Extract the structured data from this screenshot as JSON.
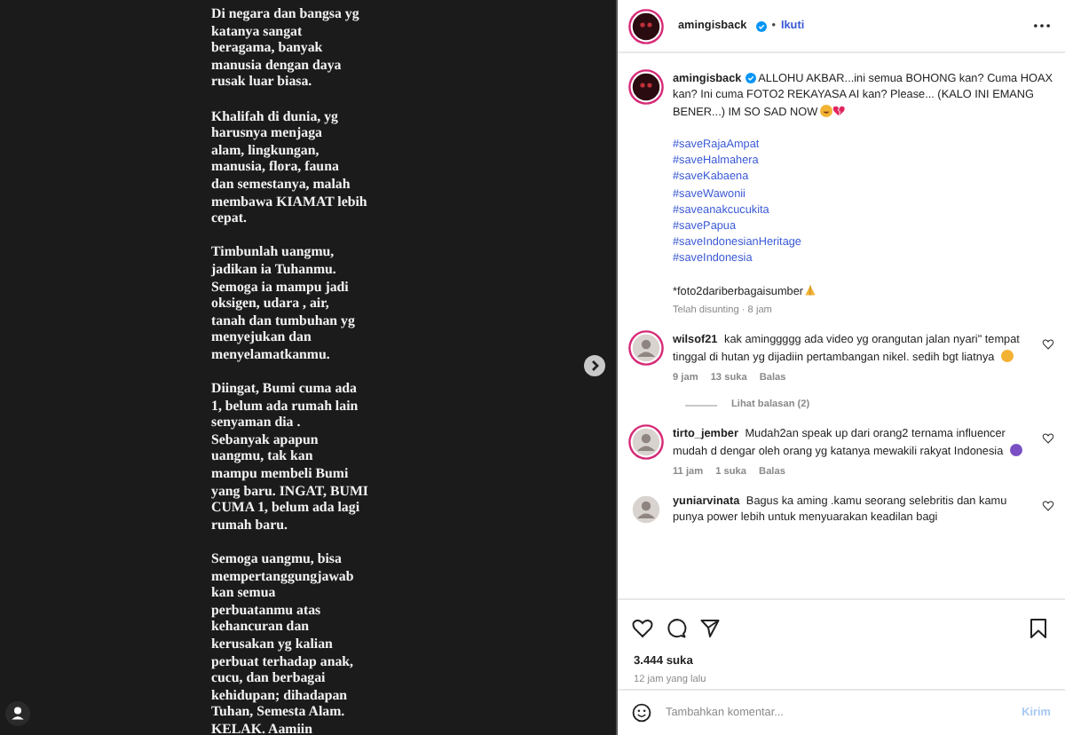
{
  "post_image": {
    "paragraphs": [
      [
        "Di negara dan bangsa yg",
        "katanya sangat",
        "beragama, banyak",
        "manusia dengan daya",
        "rusak luar biasa."
      ],
      [
        "Khalifah di dunia, yg",
        "harusnya menjaga",
        "alam, lingkungan,",
        "manusia, flora, fauna",
        "dan semestanya, malah",
        "membawa KIAMAT lebih",
        "cepat."
      ],
      [
        "Timbunlah uangmu,",
        "jadikan ia Tuhanmu.",
        "Semoga ia mampu jadi",
        "oksigen, udara , air,",
        "tanah dan tumbuhan yg",
        "menyejukan dan",
        "menyelamatkanmu."
      ],
      [
        "Diingat, Bumi cuma ada",
        "1, belum  ada rumah lain",
        "senyaman dia .",
        "Sebanyak apapun",
        "uangmu, tak kan",
        "mampu membeli Bumi",
        "yang baru. INGAT, BUMI",
        "CUMA 1, belum ada lagi",
        "rumah baru."
      ],
      [
        "Semoga uangmu, bisa",
        "mempertanggungjawab",
        "kan semua",
        "perbuatanmu atas",
        "kehancuran dan",
        "kerusakan yg kalian",
        "perbuat terhadap anak,",
        "cucu, dan berbagai",
        "kehidupan; dihadapan",
        "Tuhan, Semesta Alam.",
        "KELAK. Aamiin"
      ]
    ]
  },
  "header": {
    "username": "amingisback",
    "verified": true,
    "separator": "•",
    "follow": "Ikuti"
  },
  "caption": {
    "username": "amingisback",
    "verified": true,
    "text": "ALLOHU AKBAR...ini semua BOHONG kan? Cuma HOAX kan? Ini cuma FOTO2 REKAYASA AI kan? Please... (KALO INI EMANG BENER...) IM SO SAD NOW",
    "hashtags": [
      "#saveRajaAmpat",
      "#saveHalmahera",
      "#saveKabaena",
      "#saveWawonii",
      "#saveanakcucukita",
      "#savePapua",
      "#saveIndonesianHeritage",
      "#saveIndonesia"
    ],
    "note": "*foto2dariberbagaisumber",
    "meta": "Telah disunting · 8 jam"
  },
  "comments": [
    {
      "username": "wilsof21",
      "text": "kak aminggggg ada video yg orangutan jalan nyari\" tempat tinggal di hutan yg dijadiin pertambangan nikel. sedih bgt liatnya",
      "color": "#f2b233",
      "time": "9 jam",
      "likes": "13 suka",
      "reply": "Balas",
      "view_replies": "Lihat balasan (2)"
    },
    {
      "username": "tirto_jember",
      "text": "Mudah2an speak up dari orang2 ternama influencer mudah d dengar oleh orang yg katanya mewakili rakyat Indonesia",
      "color": "#7a4fc4",
      "time": "11 jam",
      "likes": "1 suka",
      "reply": "Balas"
    },
    {
      "username": "yuniarvinata",
      "text": "Bagus ka aming .kamu seorang selebritis dan kamu punya power lebih untuk menyuarakan keadilan bagi"
    }
  ],
  "likes": "3.444 suka",
  "posted": "12 jam yang lalu",
  "comment_box": {
    "placeholder": "Tambahkan komentar...",
    "submit": "Kirim"
  }
}
